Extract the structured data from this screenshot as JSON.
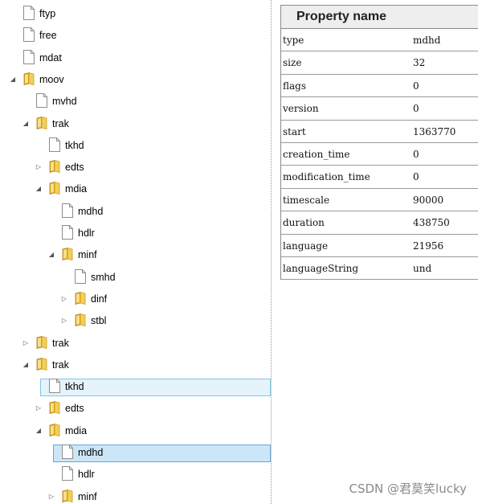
{
  "tree": {
    "nodes": [
      {
        "label": "ftyp",
        "depth": 0,
        "kind": "file",
        "exp": ""
      },
      {
        "label": "free",
        "depth": 0,
        "kind": "file",
        "exp": ""
      },
      {
        "label": "mdat",
        "depth": 0,
        "kind": "file",
        "exp": ""
      },
      {
        "label": "moov",
        "depth": 0,
        "kind": "folder",
        "exp": "open"
      },
      {
        "label": "mvhd",
        "depth": 1,
        "kind": "file",
        "exp": ""
      },
      {
        "label": "trak",
        "depth": 1,
        "kind": "folder",
        "exp": "open"
      },
      {
        "label": "tkhd",
        "depth": 2,
        "kind": "file",
        "exp": ""
      },
      {
        "label": "edts",
        "depth": 2,
        "kind": "folder",
        "exp": "closed"
      },
      {
        "label": "mdia",
        "depth": 2,
        "kind": "folder",
        "exp": "open"
      },
      {
        "label": "mdhd",
        "depth": 3,
        "kind": "file",
        "exp": ""
      },
      {
        "label": "hdlr",
        "depth": 3,
        "kind": "file",
        "exp": ""
      },
      {
        "label": "minf",
        "depth": 3,
        "kind": "folder",
        "exp": "open"
      },
      {
        "label": "smhd",
        "depth": 4,
        "kind": "file",
        "exp": ""
      },
      {
        "label": "dinf",
        "depth": 4,
        "kind": "folder",
        "exp": "closed"
      },
      {
        "label": "stbl",
        "depth": 4,
        "kind": "folder",
        "exp": "closed"
      },
      {
        "label": "trak",
        "depth": 1,
        "kind": "folder",
        "exp": "closed"
      },
      {
        "label": "trak",
        "depth": 1,
        "kind": "folder",
        "exp": "open"
      },
      {
        "label": "tkhd",
        "depth": 2,
        "kind": "file",
        "exp": "",
        "state": "hover"
      },
      {
        "label": "edts",
        "depth": 2,
        "kind": "folder",
        "exp": "closed"
      },
      {
        "label": "mdia",
        "depth": 2,
        "kind": "folder",
        "exp": "open"
      },
      {
        "label": "mdhd",
        "depth": 3,
        "kind": "file",
        "exp": "",
        "state": "selected"
      },
      {
        "label": "hdlr",
        "depth": 3,
        "kind": "file",
        "exp": ""
      },
      {
        "label": "minf",
        "depth": 3,
        "kind": "folder",
        "exp": "closed"
      }
    ]
  },
  "properties": {
    "header": "Property name",
    "rows": [
      {
        "name": "type",
        "value": "mdhd"
      },
      {
        "name": "size",
        "value": "32"
      },
      {
        "name": "flags",
        "value": "0"
      },
      {
        "name": "version",
        "value": "0"
      },
      {
        "name": "start",
        "value": "1363770"
      },
      {
        "name": "creation_time",
        "value": "0"
      },
      {
        "name": "modification_time",
        "value": "0"
      },
      {
        "name": "timescale",
        "value": "90000"
      },
      {
        "name": "duration",
        "value": "438750"
      },
      {
        "name": "language",
        "value": "21956"
      },
      {
        "name": "languageString",
        "value": "und"
      }
    ]
  },
  "watermark": "CSDN @君莫笑lucky",
  "colors": {
    "hover_bg": "#e5f3fb",
    "selected_bg": "#cde6f7",
    "folder": "#e8b939"
  }
}
